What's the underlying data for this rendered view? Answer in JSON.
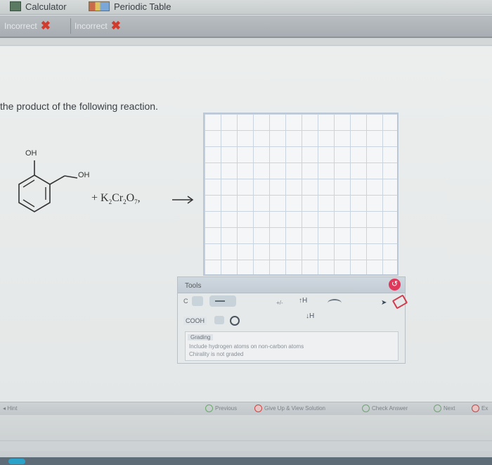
{
  "toolbar": {
    "calculator_label": "Calculator",
    "periodic_table_label": "Periodic Table"
  },
  "feedback": {
    "items": [
      {
        "label": "Incorrect"
      },
      {
        "label": "Incorrect"
      }
    ]
  },
  "question": {
    "text": "the product of the following reaction.",
    "substituent_1": "OH",
    "substituent_2": "OH",
    "reagent_plus": "+ K",
    "reagent_sub1": "2",
    "reagent_cr": "Cr",
    "reagent_sub2": "2",
    "reagent_o": "O",
    "reagent_sub3": "7",
    "arrow": "⟶"
  },
  "tools": {
    "title": "Tools",
    "carbon_label": "C",
    "charge_label": "+/-",
    "h_up_label": "↑H",
    "h_down_label": "↓H",
    "cooh_label": "COOH",
    "undo_symbol": "↺",
    "grading": {
      "title": "Grading",
      "line1": "Include hydrogen atoms on non-carbon atoms",
      "line2": "Chirality is not graded"
    }
  },
  "nav": {
    "hint_label": "Hint",
    "previous_label": "Previous",
    "give_up_label": "Give Up & View Solution",
    "check_answer_label": "Check Answer",
    "next_label": "Next",
    "exit_label": "Ex"
  },
  "colors": {
    "incorrect_mark": "#d23a2c",
    "canvas_grid": "#c9d4de",
    "undo_button": "#e0385a"
  }
}
